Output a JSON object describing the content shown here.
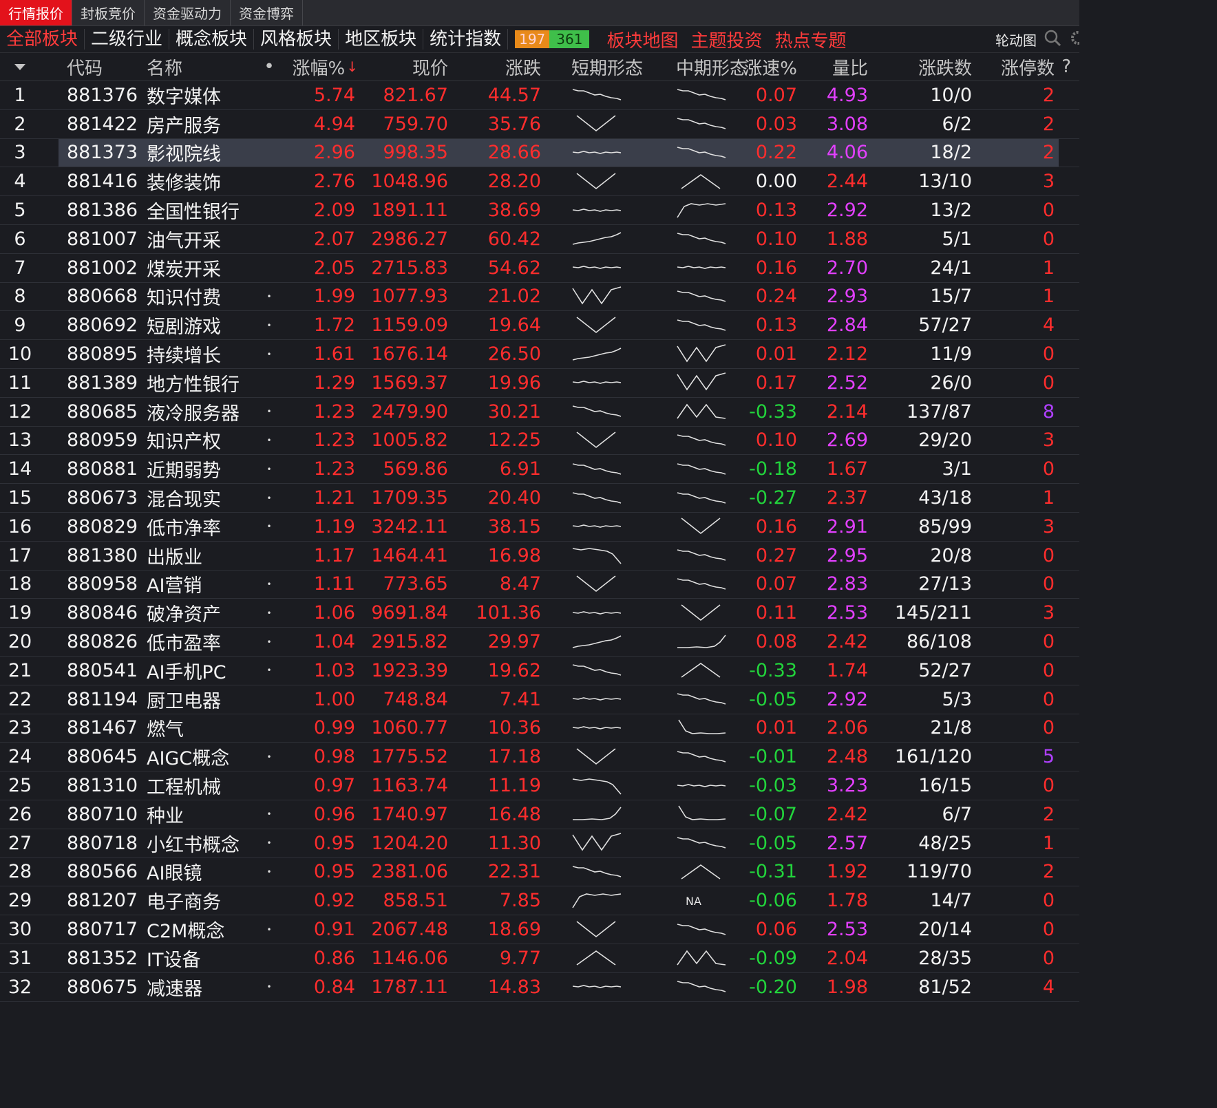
{
  "top_tabs": [
    "行情报价",
    "封板竞价",
    "资金驱动力",
    "资金博弈"
  ],
  "categories": [
    "全部板块",
    "二级行业",
    "概念板块",
    "风格板块",
    "地区板块",
    "统计指数"
  ],
  "advance_count": "197",
  "decline_count": "361",
  "special_links": [
    "板块地图",
    "主题投资",
    "热点专题"
  ],
  "right_controls": {
    "rotate_label": "轮动图",
    "help": "?"
  },
  "columns": {
    "code": "代码",
    "name": "名称",
    "dot": "•",
    "pct": "涨幅%",
    "sort_arrow": "↓",
    "price": "现价",
    "change": "涨跌",
    "short": "短期形态",
    "mid": "中期形态",
    "speed": "涨速%",
    "vol_ratio": "量比",
    "up_down": "涨跌数",
    "limit_up": "涨停数"
  },
  "colors": {
    "up": "#ff2d2d",
    "down": "#22d43c",
    "flat": "#f2f2f2",
    "vol_high": "#e340ff",
    "limit_high": "#b040ff",
    "accent": "#e3121b"
  },
  "rows": [
    {
      "idx": "1",
      "code": "881376",
      "name": "数字媒体",
      "dot": "",
      "pct": "5.74",
      "price": "821.67",
      "change": "44.57",
      "short": "down",
      "mid": "down",
      "speed": "0.07",
      "speed_dir": "up",
      "vol": "4.93",
      "vol_high": true,
      "count": "10/0",
      "limit": "2"
    },
    {
      "idx": "2",
      "code": "881422",
      "name": "房产服务",
      "dot": "",
      "pct": "4.94",
      "price": "759.70",
      "change": "35.76",
      "short": "v",
      "mid": "down",
      "speed": "0.03",
      "speed_dir": "up",
      "vol": "3.08",
      "vol_high": true,
      "count": "6/2",
      "limit": "2"
    },
    {
      "idx": "3",
      "code": "881373",
      "name": "影视院线",
      "dot": "",
      "pct": "2.96",
      "price": "998.35",
      "change": "28.66",
      "short": "flat",
      "mid": "down",
      "speed": "0.22",
      "speed_dir": "up",
      "vol": "4.06",
      "vol_high": true,
      "count": "18/2",
      "limit": "2",
      "selected": true
    },
    {
      "idx": "4",
      "code": "881416",
      "name": "装修装饰",
      "dot": "",
      "pct": "2.76",
      "price": "1048.96",
      "change": "28.20",
      "short": "v",
      "mid": "peak",
      "speed": "0.00",
      "speed_dir": "flat",
      "vol": "2.44",
      "vol_high": false,
      "count": "13/10",
      "limit": "3"
    },
    {
      "idx": "5",
      "code": "881386",
      "name": "全国性银行",
      "dot": "",
      "pct": "2.09",
      "price": "1891.11",
      "change": "38.69",
      "short": "flat",
      "mid": "rise_flat",
      "speed": "0.13",
      "speed_dir": "up",
      "vol": "2.92",
      "vol_high": true,
      "count": "13/2",
      "limit": "0"
    },
    {
      "idx": "6",
      "code": "881007",
      "name": "油气开采",
      "dot": "",
      "pct": "2.07",
      "price": "2986.27",
      "change": "60.42",
      "short": "up",
      "mid": "down",
      "speed": "0.10",
      "speed_dir": "up",
      "vol": "1.88",
      "vol_high": false,
      "count": "5/1",
      "limit": "0"
    },
    {
      "idx": "7",
      "code": "881002",
      "name": "煤炭开采",
      "dot": "",
      "pct": "2.05",
      "price": "2715.83",
      "change": "54.62",
      "short": "flat",
      "mid": "flat",
      "speed": "0.16",
      "speed_dir": "up",
      "vol": "2.70",
      "vol_high": true,
      "count": "24/1",
      "limit": "1"
    },
    {
      "idx": "8",
      "code": "880668",
      "name": "知识付费",
      "dot": "•",
      "pct": "1.99",
      "price": "1077.93",
      "change": "21.02",
      "short": "w",
      "mid": "down",
      "speed": "0.24",
      "speed_dir": "up",
      "vol": "2.93",
      "vol_high": true,
      "count": "15/7",
      "limit": "1"
    },
    {
      "idx": "9",
      "code": "880692",
      "name": "短剧游戏",
      "dot": "•",
      "pct": "1.72",
      "price": "1159.09",
      "change": "19.64",
      "short": "v",
      "mid": "down",
      "speed": "0.13",
      "speed_dir": "up",
      "vol": "2.84",
      "vol_high": true,
      "count": "57/27",
      "limit": "4"
    },
    {
      "idx": "10",
      "code": "880895",
      "name": "持续增长",
      "dot": "•",
      "pct": "1.61",
      "price": "1676.14",
      "change": "26.50",
      "short": "up",
      "mid": "w",
      "speed": "0.01",
      "speed_dir": "up",
      "vol": "2.12",
      "vol_high": false,
      "count": "11/9",
      "limit": "0"
    },
    {
      "idx": "11",
      "code": "881389",
      "name": "地方性银行",
      "dot": "",
      "pct": "1.29",
      "price": "1569.37",
      "change": "19.96",
      "short": "flat",
      "mid": "w",
      "speed": "0.17",
      "speed_dir": "up",
      "vol": "2.52",
      "vol_high": true,
      "count": "26/0",
      "limit": "0"
    },
    {
      "idx": "12",
      "code": "880685",
      "name": "液冷服务器",
      "dot": "•",
      "pct": "1.23",
      "price": "2479.90",
      "change": "30.21",
      "short": "down",
      "mid": "m",
      "speed": "-0.33",
      "speed_dir": "down",
      "vol": "2.14",
      "vol_high": false,
      "count": "137/87",
      "limit": "8",
      "limit_high": true
    },
    {
      "idx": "13",
      "code": "880959",
      "name": "知识产权",
      "dot": "•",
      "pct": "1.23",
      "price": "1005.82",
      "change": "12.25",
      "short": "v",
      "mid": "down",
      "speed": "0.10",
      "speed_dir": "up",
      "vol": "2.69",
      "vol_high": true,
      "count": "29/20",
      "limit": "3"
    },
    {
      "idx": "14",
      "code": "880881",
      "name": "近期弱势",
      "dot": "•",
      "pct": "1.23",
      "price": "569.86",
      "change": "6.91",
      "short": "down",
      "mid": "down",
      "speed": "-0.18",
      "speed_dir": "down",
      "vol": "1.67",
      "vol_high": false,
      "count": "3/1",
      "limit": "0"
    },
    {
      "idx": "15",
      "code": "880673",
      "name": "混合现实",
      "dot": "•",
      "pct": "1.21",
      "price": "1709.35",
      "change": "20.40",
      "short": "down",
      "mid": "down",
      "speed": "-0.27",
      "speed_dir": "down",
      "vol": "2.37",
      "vol_high": false,
      "count": "43/18",
      "limit": "1"
    },
    {
      "idx": "16",
      "code": "880829",
      "name": "低市净率",
      "dot": "•",
      "pct": "1.19",
      "price": "3242.11",
      "change": "38.15",
      "short": "flat",
      "mid": "v",
      "speed": "0.16",
      "speed_dir": "up",
      "vol": "2.91",
      "vol_high": true,
      "count": "85/99",
      "limit": "3"
    },
    {
      "idx": "17",
      "code": "881380",
      "name": "出版业",
      "dot": "",
      "pct": "1.17",
      "price": "1464.41",
      "change": "16.98",
      "short": "flat_drop",
      "mid": "down",
      "speed": "0.27",
      "speed_dir": "up",
      "vol": "2.95",
      "vol_high": true,
      "count": "20/8",
      "limit": "0"
    },
    {
      "idx": "18",
      "code": "880958",
      "name": "AI营销",
      "dot": "•",
      "pct": "1.11",
      "price": "773.65",
      "change": "8.47",
      "short": "v",
      "mid": "down",
      "speed": "0.07",
      "speed_dir": "up",
      "vol": "2.83",
      "vol_high": true,
      "count": "27/13",
      "limit": "0"
    },
    {
      "idx": "19",
      "code": "880846",
      "name": "破净资产",
      "dot": "•",
      "pct": "1.06",
      "price": "9691.84",
      "change": "101.36",
      "short": "flat",
      "mid": "v",
      "speed": "0.11",
      "speed_dir": "up",
      "vol": "2.53",
      "vol_high": true,
      "count": "145/211",
      "limit": "3"
    },
    {
      "idx": "20",
      "code": "880826",
      "name": "低市盈率",
      "dot": "•",
      "pct": "1.04",
      "price": "2915.82",
      "change": "29.97",
      "short": "up",
      "mid": "flat_rise",
      "speed": "0.08",
      "speed_dir": "up",
      "vol": "2.42",
      "vol_high": false,
      "count": "86/108",
      "limit": "0"
    },
    {
      "idx": "21",
      "code": "880541",
      "name": "AI手机PC",
      "dot": "•",
      "pct": "1.03",
      "price": "1923.39",
      "change": "19.62",
      "short": "down",
      "mid": "peak",
      "speed": "-0.33",
      "speed_dir": "down",
      "vol": "1.74",
      "vol_high": false,
      "count": "52/27",
      "limit": "0"
    },
    {
      "idx": "22",
      "code": "881194",
      "name": "厨卫电器",
      "dot": "",
      "pct": "1.00",
      "price": "748.84",
      "change": "7.41",
      "short": "flat",
      "mid": "down",
      "speed": "-0.05",
      "speed_dir": "down",
      "vol": "2.92",
      "vol_high": true,
      "count": "5/3",
      "limit": "0"
    },
    {
      "idx": "23",
      "code": "881467",
      "name": "燃气",
      "dot": "",
      "pct": "0.99",
      "price": "1060.77",
      "change": "10.36",
      "short": "flat",
      "mid": "drop_flat",
      "speed": "0.01",
      "speed_dir": "up",
      "vol": "2.06",
      "vol_high": false,
      "count": "21/8",
      "limit": "0"
    },
    {
      "idx": "24",
      "code": "880645",
      "name": "AIGC概念",
      "dot": "•",
      "pct": "0.98",
      "price": "1775.52",
      "change": "17.18",
      "short": "v",
      "mid": "down",
      "speed": "-0.01",
      "speed_dir": "down",
      "vol": "2.48",
      "vol_high": false,
      "count": "161/120",
      "limit": "5",
      "limit_high": true
    },
    {
      "idx": "25",
      "code": "881310",
      "name": "工程机械",
      "dot": "",
      "pct": "0.97",
      "price": "1163.74",
      "change": "11.19",
      "short": "flat_drop",
      "mid": "flat",
      "speed": "-0.03",
      "speed_dir": "down",
      "vol": "3.23",
      "vol_high": true,
      "count": "16/15",
      "limit": "0"
    },
    {
      "idx": "26",
      "code": "880710",
      "name": "种业",
      "dot": "•",
      "pct": "0.96",
      "price": "1740.97",
      "change": "16.48",
      "short": "flat_rise",
      "mid": "drop_flat",
      "speed": "-0.07",
      "speed_dir": "down",
      "vol": "2.42",
      "vol_high": false,
      "count": "6/7",
      "limit": "2"
    },
    {
      "idx": "27",
      "code": "880718",
      "name": "小红书概念",
      "dot": "•",
      "pct": "0.95",
      "price": "1204.20",
      "change": "11.30",
      "short": "w",
      "mid": "down",
      "speed": "-0.05",
      "speed_dir": "down",
      "vol": "2.57",
      "vol_high": true,
      "count": "48/25",
      "limit": "1"
    },
    {
      "idx": "28",
      "code": "880566",
      "name": "AI眼镜",
      "dot": "•",
      "pct": "0.95",
      "price": "2381.06",
      "change": "22.31",
      "short": "down",
      "mid": "peak",
      "speed": "-0.31",
      "speed_dir": "down",
      "vol": "1.92",
      "vol_high": false,
      "count": "119/70",
      "limit": "2"
    },
    {
      "idx": "29",
      "code": "881207",
      "name": "电子商务",
      "dot": "",
      "pct": "0.92",
      "price": "858.51",
      "change": "7.85",
      "short": "rise_flat",
      "mid": "na",
      "speed": "-0.06",
      "speed_dir": "down",
      "vol": "1.78",
      "vol_high": false,
      "count": "14/7",
      "limit": "0"
    },
    {
      "idx": "30",
      "code": "880717",
      "name": "C2M概念",
      "dot": "•",
      "pct": "0.91",
      "price": "2067.48",
      "change": "18.69",
      "short": "v",
      "mid": "down",
      "speed": "0.06",
      "speed_dir": "up",
      "vol": "2.53",
      "vol_high": true,
      "count": "20/14",
      "limit": "0"
    },
    {
      "idx": "31",
      "code": "881352",
      "name": "IT设备",
      "dot": "",
      "pct": "0.86",
      "price": "1146.06",
      "change": "9.77",
      "short": "peak",
      "mid": "m",
      "speed": "-0.09",
      "speed_dir": "down",
      "vol": "2.04",
      "vol_high": false,
      "count": "28/35",
      "limit": "0"
    },
    {
      "idx": "32",
      "code": "880675",
      "name": "减速器",
      "dot": "•",
      "pct": "0.84",
      "price": "1787.11",
      "change": "14.83",
      "short": "flat",
      "mid": "down",
      "speed": "-0.20",
      "speed_dir": "down",
      "vol": "1.98",
      "vol_high": false,
      "count": "81/52",
      "limit": "4"
    }
  ]
}
